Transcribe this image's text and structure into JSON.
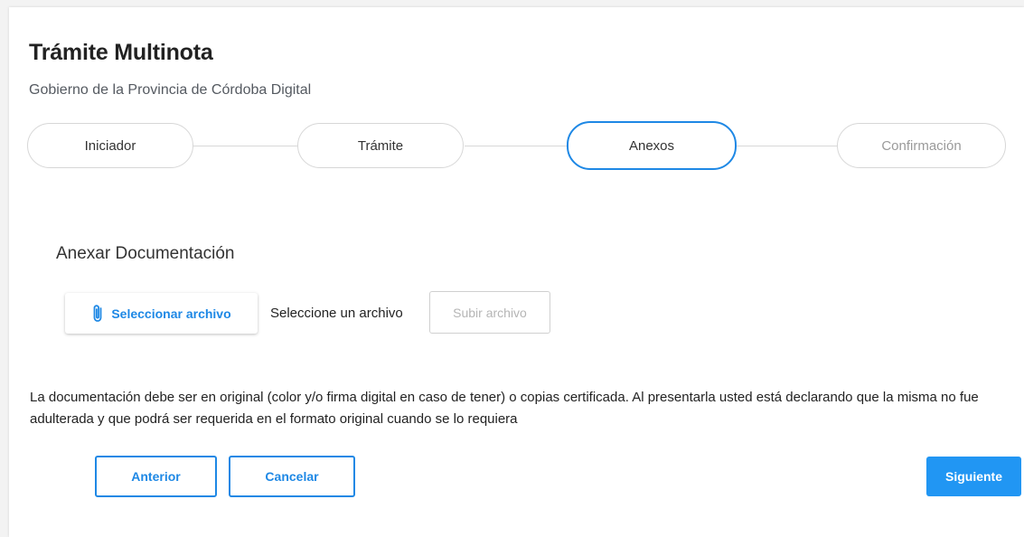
{
  "header": {
    "title": "Trámite Multinota",
    "subtitle": "Gobierno de la Provincia de Córdoba Digital"
  },
  "stepper": {
    "steps": [
      {
        "label": "Iniciador",
        "state": "done"
      },
      {
        "label": "Trámite",
        "state": "done"
      },
      {
        "label": "Anexos",
        "state": "active"
      },
      {
        "label": "Confirmación",
        "state": "disabled"
      }
    ]
  },
  "attachments": {
    "section_title": "Anexar Documentación",
    "select_button_label": "Seleccionar archivo",
    "select_button_icon": "paperclip-icon",
    "file_status": "Seleccione un archivo",
    "upload_button_label": "Subir archivo"
  },
  "note": "La documentación debe ser en original (color y/o firma digital en caso de tener) o copias certificada. Al presentarla usted está declarando que la misma no fue adulterada y que podrá ser requerida en el formato original cuando se lo requiera",
  "actions": {
    "previous_label": "Anterior",
    "cancel_label": "Cancelar",
    "next_label": "Siguiente"
  },
  "colors": {
    "accent": "#1e88e5",
    "primary_button": "#2196f3",
    "disabled_text": "#9a9a9a"
  }
}
